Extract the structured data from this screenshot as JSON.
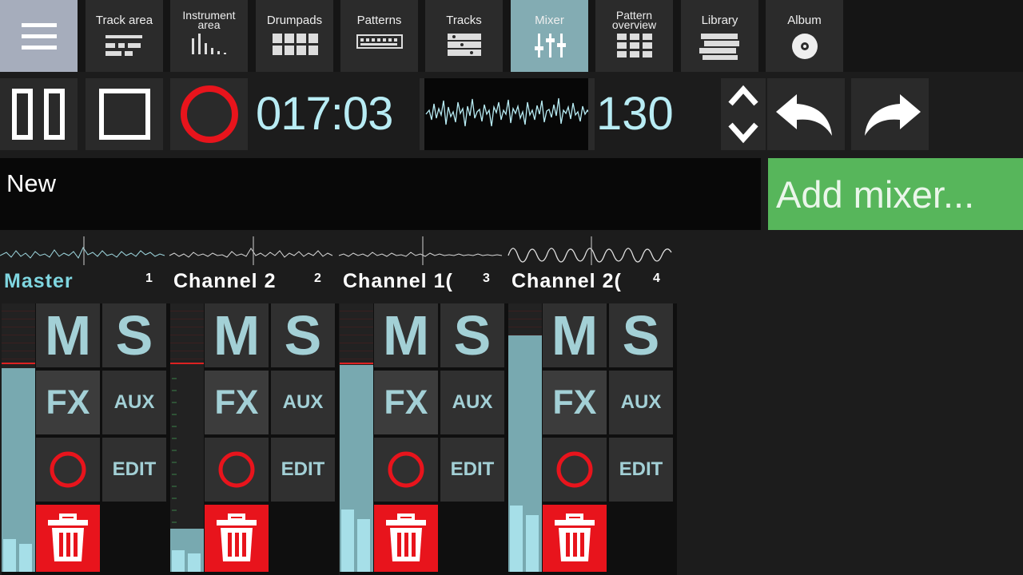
{
  "nav": {
    "tabs": [
      {
        "label": "Track area",
        "icon": "track-area-icon"
      },
      {
        "label": "Instrument area",
        "icon": "instrument-area-icon"
      },
      {
        "label": "Drumpads",
        "icon": "drumpads-icon"
      },
      {
        "label": "Patterns",
        "icon": "patterns-icon"
      },
      {
        "label": "Tracks",
        "icon": "tracks-icon"
      },
      {
        "label": "Mixer",
        "icon": "mixer-icon"
      },
      {
        "label": "Pattern overview",
        "icon": "pattern-overview-icon"
      },
      {
        "label": "Library",
        "icon": "library-icon"
      },
      {
        "label": "Album",
        "icon": "album-icon"
      }
    ],
    "active_tab": "Mixer"
  },
  "transport": {
    "time": "017:03",
    "bpm": "130"
  },
  "project": {
    "name": "New",
    "add_mixer_label": "Add mixer..."
  },
  "channels": [
    {
      "name": "Master",
      "number": "1",
      "fader_level": 0.76
    },
    {
      "name": "Channel 2",
      "number": "2",
      "fader_level": 0.16
    },
    {
      "name": "Channel 1(",
      "number": "3",
      "fader_level": 0.77
    },
    {
      "name": "Channel 2(",
      "number": "4",
      "fader_level": 0.88
    }
  ],
  "strip_buttons": {
    "mute": "M",
    "solo": "S",
    "fx": "FX",
    "aux": "AUX",
    "edit": "EDIT"
  },
  "colors": {
    "accent": "#b8ecf4",
    "active_tab": "#83acb3",
    "record": "#e8141c",
    "add_button": "#57b65b"
  }
}
